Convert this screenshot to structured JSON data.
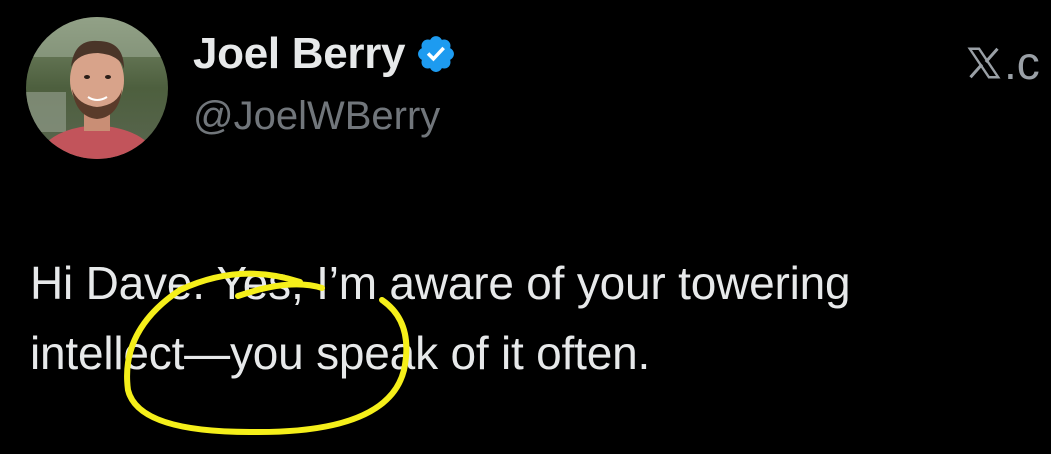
{
  "author": {
    "display_name": "Joel Berry",
    "handle": "@JoelWBerry",
    "verified": true,
    "verified_badge_color": "#1d9bf0",
    "avatar_icon": "profile-photo"
  },
  "brand": {
    "logo_icon": "x-logo-icon",
    "logo_suffix": ".c"
  },
  "tweet": {
    "lines": [
      "Hi Dave. Yes, I’m aware of your towering",
      "intellect—you speak of it often."
    ]
  },
  "annotation": {
    "color": "#f5ef1a",
    "shape": "hand-drawn-circle"
  },
  "colors": {
    "background": "#000000",
    "primary_text": "#e7e9ea",
    "secondary_text": "#71767b"
  }
}
